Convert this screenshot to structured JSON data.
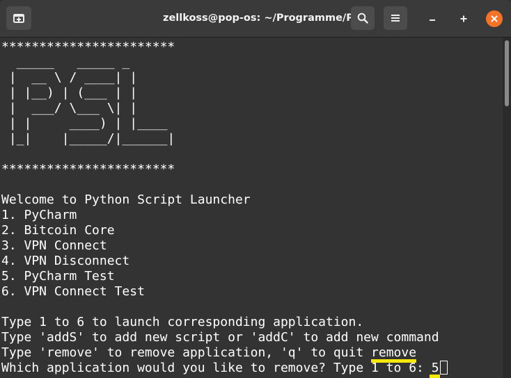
{
  "window": {
    "title": "zellkoss@pop-os: ~/Programme/PSL",
    "colors": {
      "titlebar": "#3a3a3a",
      "terminal_bg": "#333333",
      "text": "#ffffff",
      "close": "#f37329",
      "highlight": "#f5e80a"
    },
    "icons": {
      "new_tab": "new-tab-icon",
      "search": "search-icon",
      "menu": "hamburger-menu-icon",
      "minimize": "minimize-icon",
      "maximize": "maximize-icon",
      "close": "close-icon"
    }
  },
  "terminal": {
    "lines": [
      "***********************",
      "  _____   _____ _",
      " |  __ \\ / ____| |",
      " | |__) | (___ | |",
      " |  ___/ \\___ \\| |",
      " | |     ____) | |____",
      " |_|    |_____/|______|",
      "",
      "***********************",
      "",
      "Welcome to Python Script Launcher",
      "1. PyCharm",
      "2. Bitcoin Core",
      "3. VPN Connect",
      "4. VPN Disconnect",
      "5. PyCharm Test",
      "6. VPN Connect Test",
      "",
      "Type 1 to 6 to launch corresponding application.",
      "Type 'addS' to add new script or 'addC' to add new command"
    ],
    "remove_line_prefix": "Type 'remove' to remove application, 'q' to quit ",
    "remove_line_typed": "remove",
    "prompt_line": "Which application would you like to remove? Type 1 to 6: ",
    "prompt_typed": "5"
  }
}
